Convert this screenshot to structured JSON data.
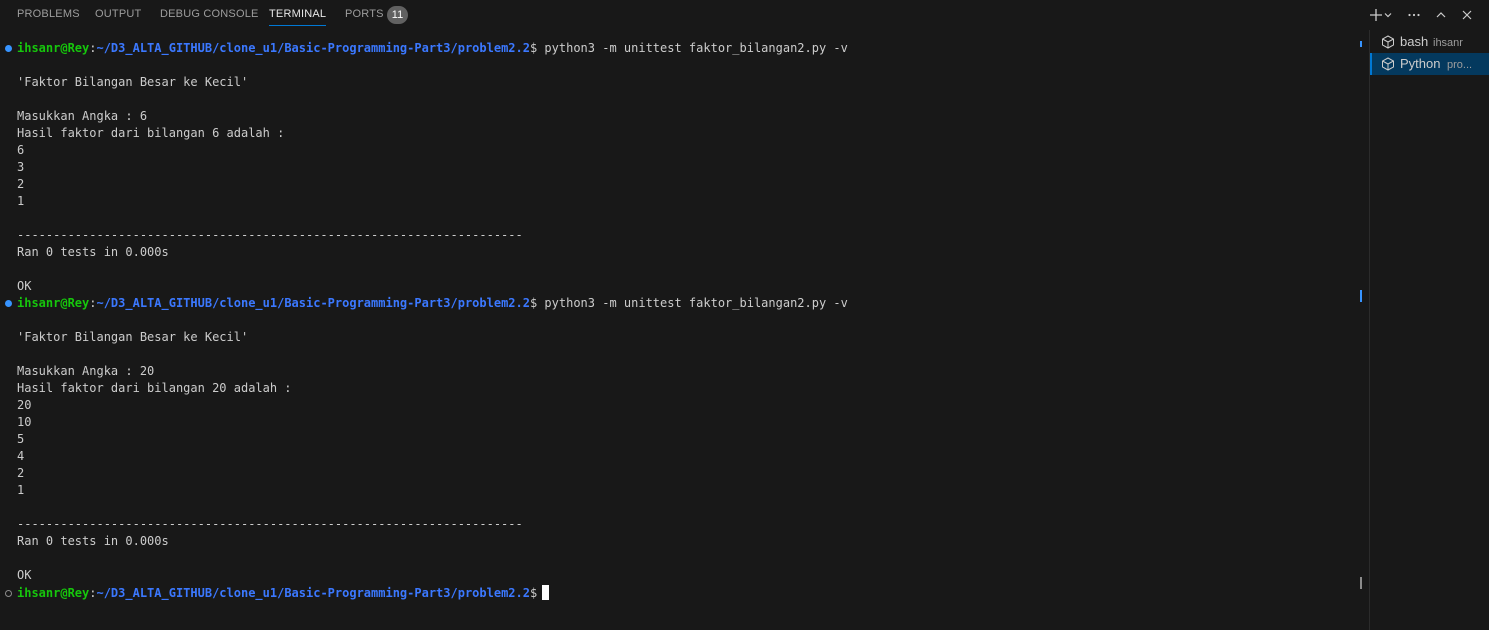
{
  "panel": {
    "tabs": [
      {
        "label": "PROBLEMS",
        "active": false
      },
      {
        "label": "OUTPUT",
        "active": false
      },
      {
        "label": "DEBUG CONSOLE",
        "active": false
      },
      {
        "label": "TERMINAL",
        "active": true
      },
      {
        "label": "PORTS",
        "active": false
      }
    ],
    "ports_badge": "11",
    "actions": [
      "plus-icon",
      "chevron-down-icon",
      "ellipsis-icon",
      "chevron-up-icon",
      "close-icon"
    ]
  },
  "terminal": {
    "prompt_user": "ihsanr@Rey",
    "prompt_sep": ":",
    "prompt_path": "~/D3_ALTA_GITHUB/clone_u1/Basic-Programming-Part3/problem2.2",
    "prompt_symbol": "$",
    "run1": {
      "command": " python3 -m unittest faktor_bilangan2.py -v",
      "title": "'Faktor Bilangan Besar ke Kecil'",
      "input_line": "Masukkan Angka : 6",
      "result_line": "Hasil faktor dari bilangan 6 adalah :",
      "factors": [
        "6",
        "3",
        "2",
        "1"
      ],
      "separator": "----------------------------------------------------------------------",
      "summary": "Ran 0 tests in 0.000s",
      "status": "OK"
    },
    "run2": {
      "command": " python3 -m unittest faktor_bilangan2.py -v",
      "title": "'Faktor Bilangan Besar ke Kecil'",
      "input_line": "Masukkan Angka : 20",
      "result_line": "Hasil faktor dari bilangan 20 adalah :",
      "factors": [
        "20",
        "10",
        "5",
        "4",
        "2",
        "1"
      ],
      "separator": "----------------------------------------------------------------------",
      "summary": "Ran 0 tests in 0.000s",
      "status": "OK"
    }
  },
  "terminal_list": [
    {
      "name": "bash",
      "desc": "ihsanr",
      "selected": false
    },
    {
      "name": "Python",
      "desc": "pro...",
      "selected": true
    }
  ],
  "colors": {
    "background": "#181818",
    "prompt_user": "#16c60c",
    "prompt_path": "#3b78ff",
    "accent": "#0078d4"
  }
}
